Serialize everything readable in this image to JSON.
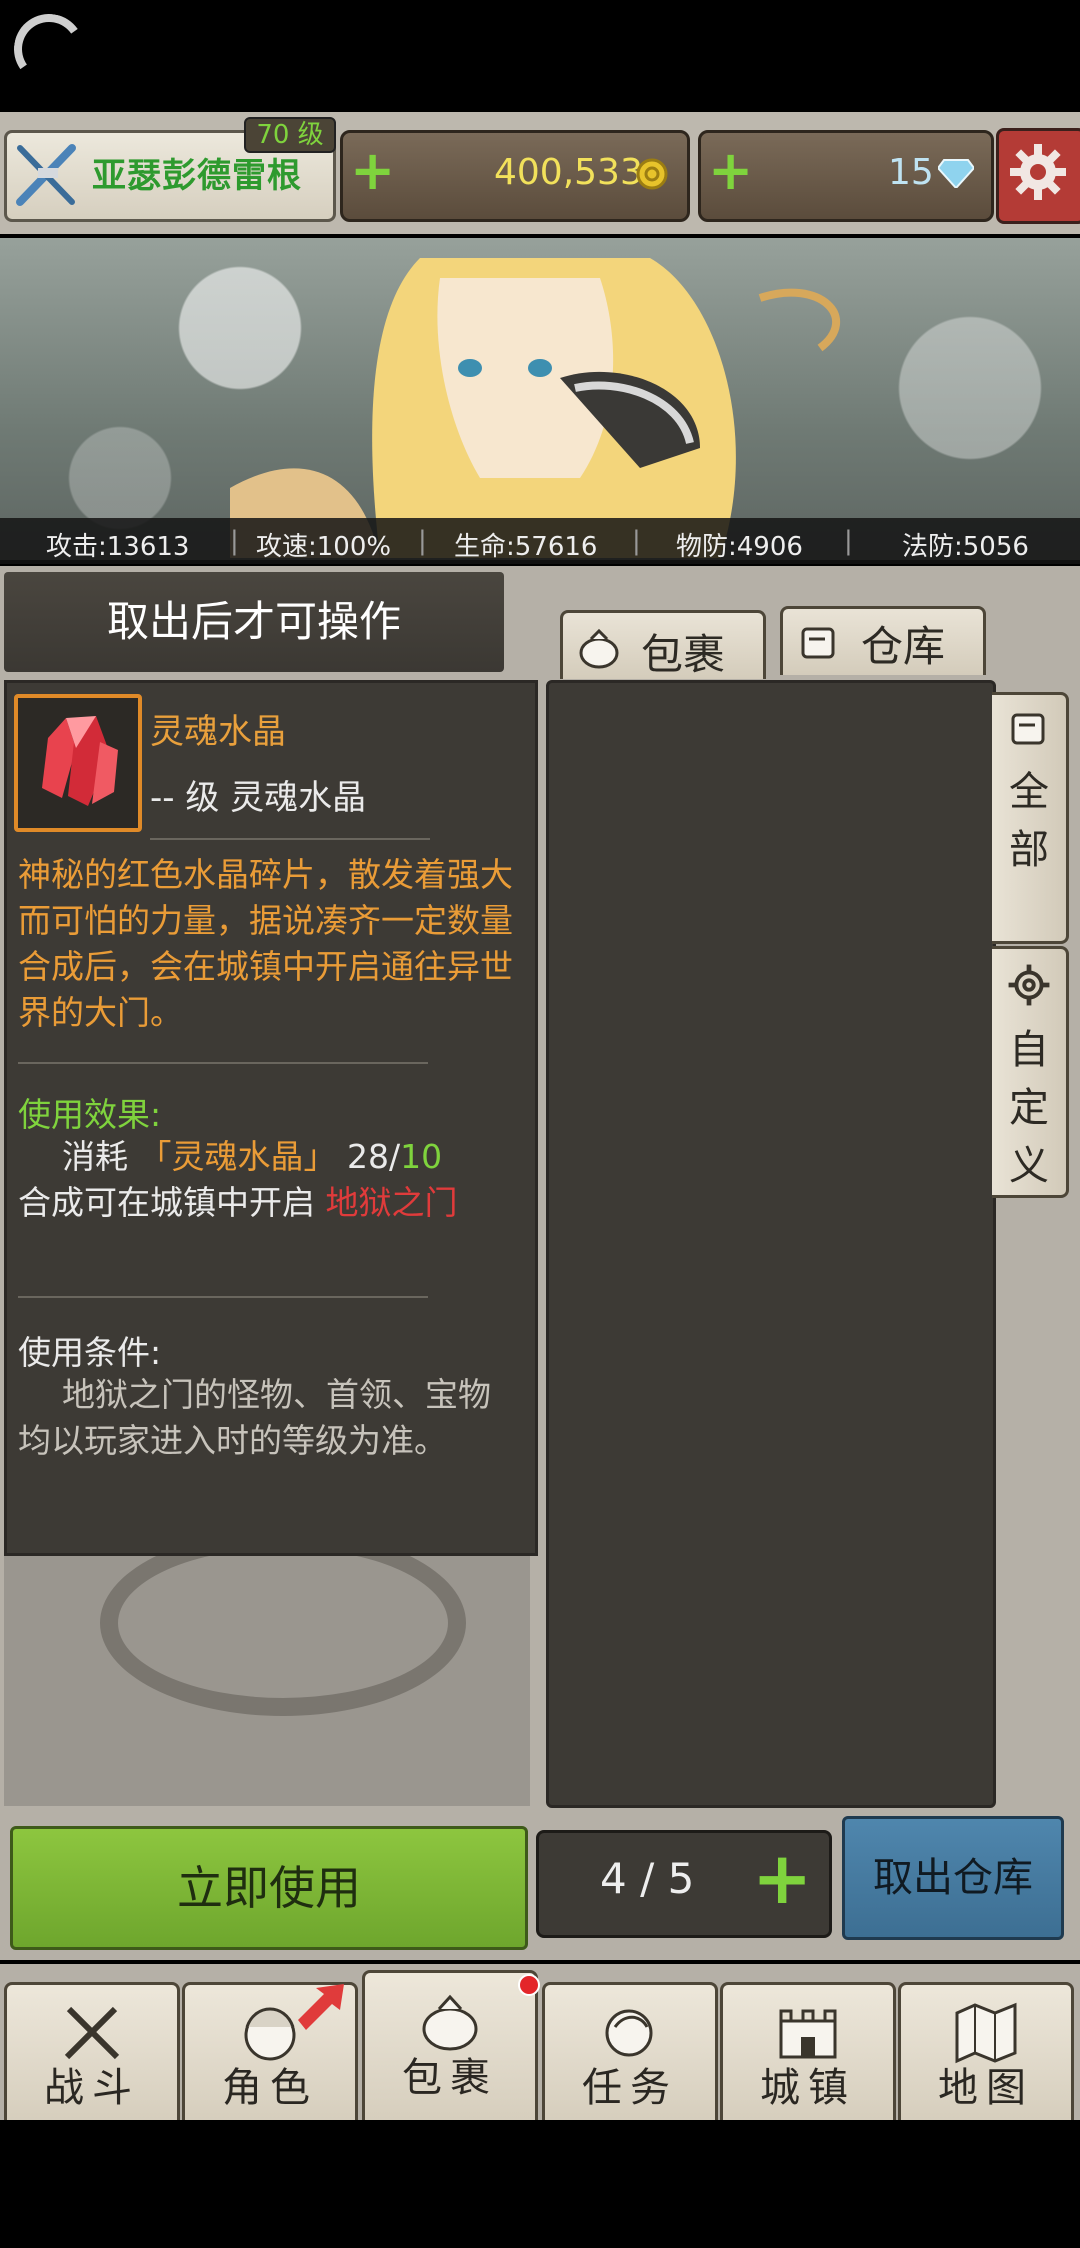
{
  "player": {
    "name": "亚瑟彭德雷根",
    "level": "70 级"
  },
  "resources": {
    "gold": "400,533",
    "gems": "15"
  },
  "stats": [
    "攻击:13613",
    "攻速:100%",
    "生命:57616",
    "物防:4906",
    "法防:5056"
  ],
  "left_header": "取出后才可操作",
  "tabs": {
    "bag": "包裹",
    "warehouse": "仓库"
  },
  "side_tabs": {
    "all_1": "全",
    "all_2": "部",
    "custom_1": "自",
    "custom_2": "定",
    "custom_3": "义"
  },
  "item": {
    "name": "灵魂水晶",
    "level_line": "-- 级 灵魂水晶",
    "description": "神秘的红色水晶碎片，散发着强大而可怕的力量，据说凑齐一定数量合成后，会在城镇中开启通往异世界的大门。",
    "effect_title": "使用效果:",
    "effect_prefix": "消耗",
    "effect_item": "「灵魂水晶」",
    "effect_owned": "28/",
    "effect_required": "10",
    "effect_line2": "合成可在城镇中开启",
    "effect_target": "地狱之门",
    "condition_title": "使用条件:",
    "condition_text": "地狱之门的怪物、首领、宝物均以玩家进入时的等级为准。"
  },
  "buttons": {
    "use_now": "立即使用",
    "quantity": "4 / 5",
    "withdraw": "取出仓库"
  },
  "nav": [
    {
      "label": "战斗"
    },
    {
      "label": "角色"
    },
    {
      "label": "包裹"
    },
    {
      "label": "任务"
    },
    {
      "label": "城镇"
    },
    {
      "label": "地图"
    }
  ],
  "colors": {
    "accent_green": "#7fd33d",
    "item_orange": "#ea9c37",
    "danger_red": "#e03b3b",
    "gold_text": "#f2e15b"
  }
}
